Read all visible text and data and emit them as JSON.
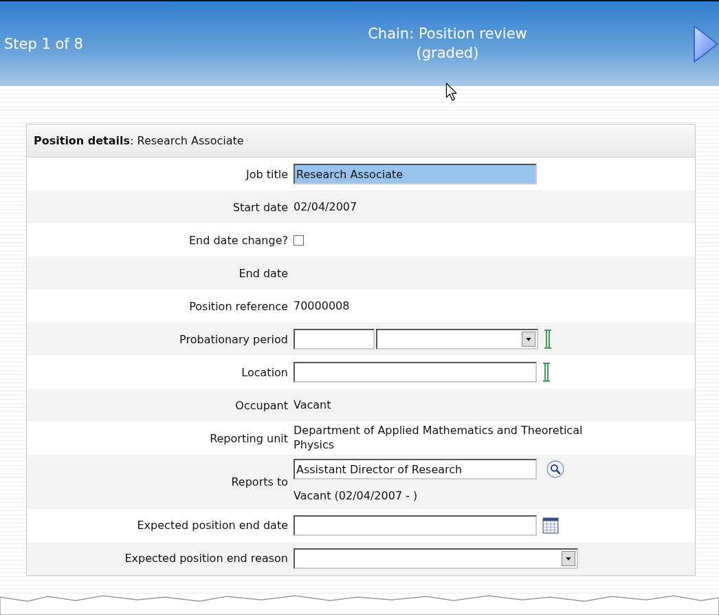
{
  "header": {
    "step": "Step 1 of 8",
    "title": "Chain: Position review",
    "subtitle": "(graded)"
  },
  "panel": {
    "heading": "**Position details**: Research Associate",
    "rows": [
      {
        "kind": "input",
        "label": "Job title",
        "value": "Research Associate",
        "highlighted": true
      },
      {
        "kind": "text",
        "label": "Start date",
        "value": "02/04/2007"
      },
      {
        "kind": "checkbox",
        "label": "End date change?",
        "checked": false
      },
      {
        "kind": "text",
        "label": "End date"
      },
      {
        "kind": "text",
        "label": "Position reference",
        "value": "70000008"
      },
      {
        "kind": "split-select",
        "label": "Probationary period",
        "required": true
      },
      {
        "kind": "input",
        "label": "Location",
        "required": true
      },
      {
        "kind": "text",
        "label": "Occupant",
        "value": "Vacant"
      },
      {
        "kind": "text",
        "label": "Reporting unit",
        "value": "Department of Applied Mathematics and Theoretical Physics"
      },
      {
        "kind": "lookup",
        "label": "Reports to",
        "value": "Assistant Director of Research",
        "note": "Vacant (02/04/2007 - )"
      },
      {
        "kind": "date",
        "label": "Expected position end date"
      },
      {
        "kind": "select",
        "label": "Expected position end reason"
      }
    ]
  }
}
